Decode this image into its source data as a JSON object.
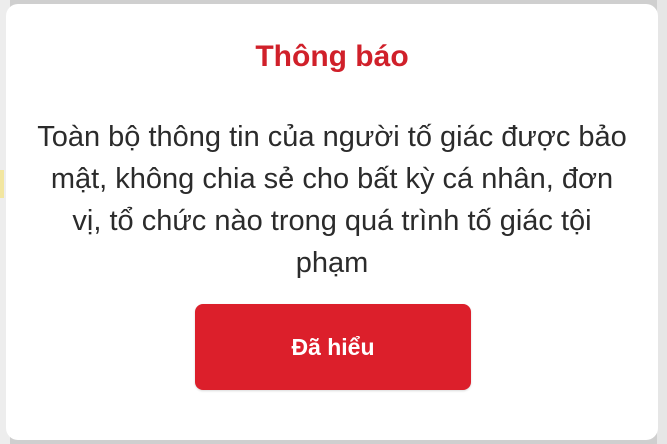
{
  "dialog": {
    "title": "Thông báo",
    "message": "Toàn bộ thông tin của người tố giác được bảo mật, không chia sẻ cho bất kỳ cá nhân, đơn vị, tổ chức nào trong quá trình tố giác tội phạm",
    "confirm_label": "Đã hiểu"
  },
  "colors": {
    "accent": "#dc1f2b",
    "title": "#d0202a",
    "text": "#2b2b2b",
    "dialog_bg": "#ffffff"
  }
}
